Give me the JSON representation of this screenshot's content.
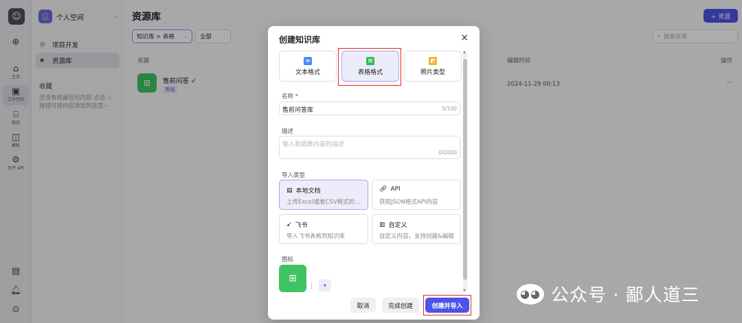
{
  "rail": {
    "items": [
      {
        "label": "",
        "icon": "plus-icon"
      },
      {
        "label": "主页",
        "icon": "home-icon"
      },
      {
        "label": "工作空间",
        "icon": "terminal-icon"
      },
      {
        "label": "商店",
        "icon": "store-icon"
      },
      {
        "label": "模板",
        "icon": "template-icon"
      },
      {
        "label": "扣子 API",
        "icon": "api-icon"
      }
    ],
    "bottom_icons": [
      "doc-icon",
      "bell-icon",
      "upload-icon"
    ]
  },
  "sidebar": {
    "space_name": "个人空间",
    "nav": [
      {
        "label": "项目开发"
      },
      {
        "label": "资源库"
      }
    ],
    "favorites_title": "收藏",
    "favorites_empty": "还没有收藏任何内容 点击 ☆ 按钮可将内容添加到这里~"
  },
  "main": {
    "title": "资源库",
    "add_button": "+ 资源",
    "filter_type": "知识库 > 表格",
    "filter_scope": "全部",
    "search_placeholder": "搜索资源",
    "columns": {
      "resource": "资源",
      "edit_time": "编辑时间",
      "actions": "操作"
    },
    "rows": [
      {
        "name": "售前问答",
        "tag": "表格",
        "edit_time": "2024-11-29 00:13",
        "more": "···"
      }
    ]
  },
  "modal": {
    "title": "创建知识库",
    "close": "×",
    "formats": [
      {
        "label": "文本格式",
        "color": "#4a8cf7"
      },
      {
        "label": "表格格式",
        "color": "#2fbd5c"
      },
      {
        "label": "照片类型",
        "color": "#f2b32a"
      }
    ],
    "name_label": "名称",
    "name_required": "*",
    "name_value": "售前问答库",
    "name_count": "5/100",
    "desc_label": "描述",
    "desc_placeholder": "输入数据集内容的描述",
    "desc_count": "0/2000",
    "import_label": "导入类型",
    "import_types": [
      {
        "title": "本地文档",
        "desc": "上传Excel或者CSV格式的…",
        "icon": "file-icon"
      },
      {
        "title": "API",
        "desc": "获取JSON格式API内容",
        "icon": "link-icon"
      },
      {
        "title": "飞书",
        "desc": "导入飞书表格到知识库",
        "icon": "feishu-icon"
      },
      {
        "title": "自定义",
        "desc": "自定义内容，支持创建&编辑",
        "icon": "edit-doc-icon"
      }
    ],
    "icon_label": "图标",
    "buttons": {
      "cancel": "取消",
      "done": "完成创建",
      "create_import": "创建并导入"
    }
  },
  "watermark": "公众号 · 鄙人道三",
  "colors": {
    "accent": "#4d53e8",
    "table_green": "#3ec462",
    "highlight_border": "#e02323"
  }
}
